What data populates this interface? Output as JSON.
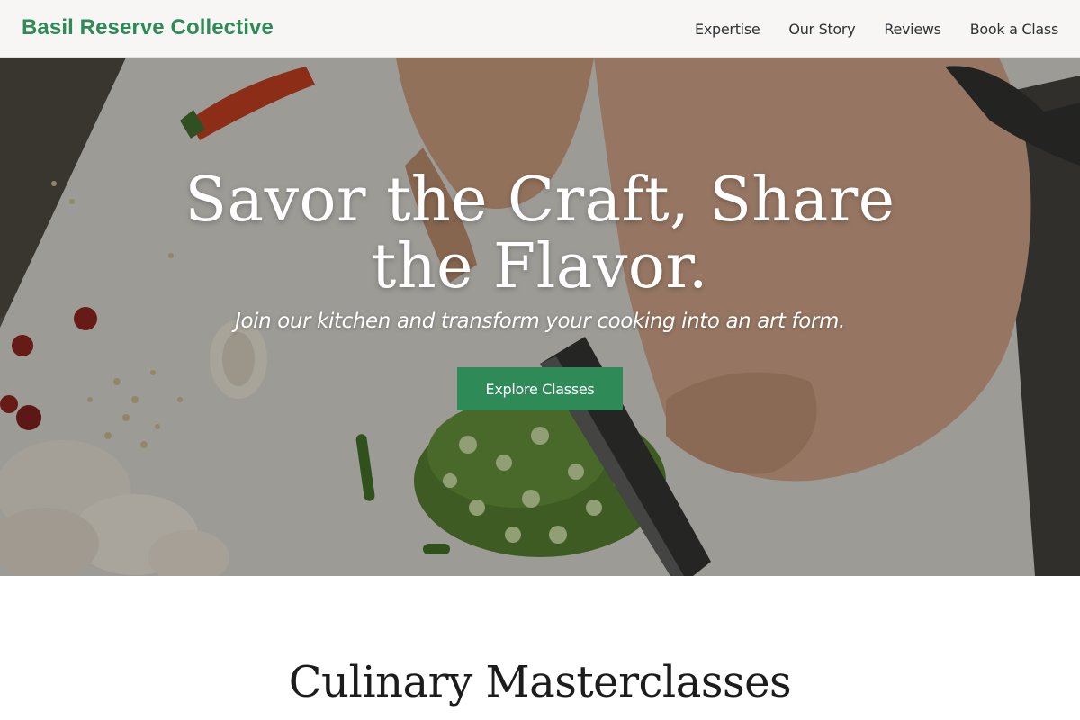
{
  "header": {
    "brand": "Basil Reserve Collective",
    "nav": [
      "Expertise",
      "Our Story",
      "Reviews",
      "Book a Class"
    ]
  },
  "hero": {
    "title": "Savor the Craft, Share the Flavor.",
    "subtitle": "Join our kitchen and transform your cooking into an art form.",
    "cta_label": "Explore Classes",
    "image": "chef-chopping-okra-photo"
  },
  "section": {
    "title": "Culinary Masterclasses"
  },
  "colors": {
    "accent": "#2e8b57",
    "nav_text": "#2f3338",
    "heading": "#1c1c1c"
  }
}
